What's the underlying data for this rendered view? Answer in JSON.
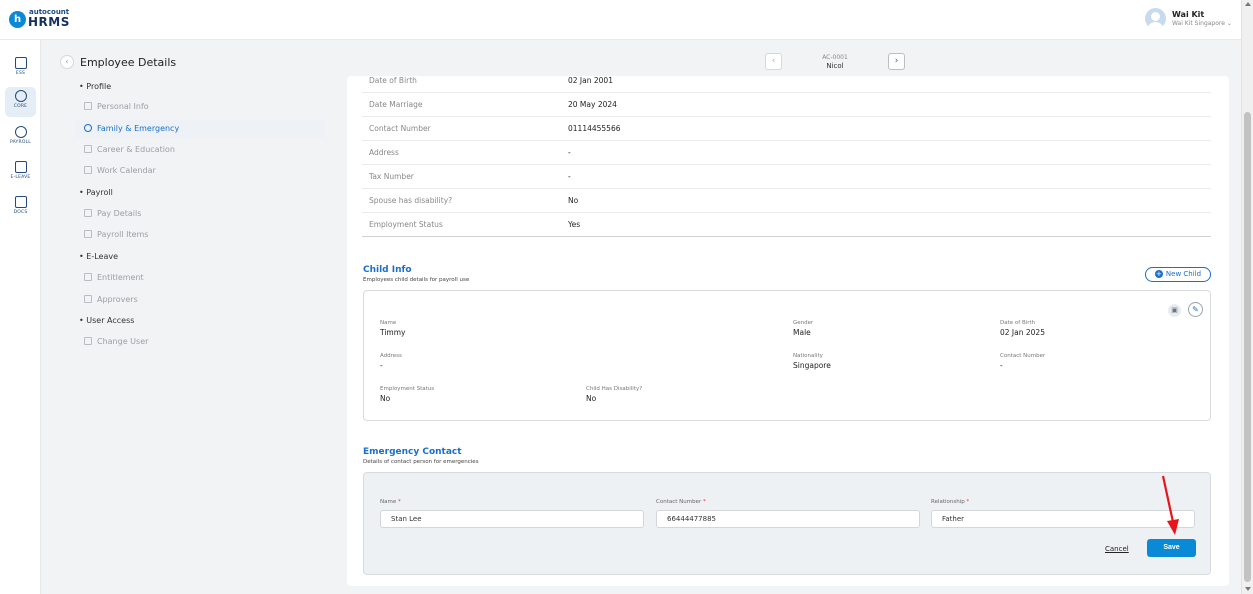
{
  "brand": {
    "logo_letter": "h",
    "small": "autocount",
    "big": "HRMS"
  },
  "user": {
    "name": "Wai Kit",
    "company": "Wai Kit Singapore ⌄"
  },
  "nav": [
    {
      "label": "ESS",
      "icon": "ess-icon"
    },
    {
      "label": "CORE",
      "icon": "core-icon",
      "active": true
    },
    {
      "label": "PAYROLL",
      "icon": "payroll-icon"
    },
    {
      "label": "E-LEAVE",
      "icon": "calendar-icon"
    },
    {
      "label": "DOCS",
      "icon": "docs-icon"
    }
  ],
  "header": {
    "title": "Employee Details",
    "emp_code": "AC-0001",
    "emp_name": "Nicol"
  },
  "menu": {
    "groups": [
      "Profile",
      "Payroll",
      "E-Leave",
      "User Access"
    ],
    "items": [
      "Personal Info",
      "Family & Emergency",
      "Career & Education",
      "Work Calendar",
      "Pay Details",
      "Payroll Items",
      "Entitlement",
      "Approvers",
      "Change User"
    ]
  },
  "spouse": [
    {
      "label": "Date of Birth",
      "value": "02 Jan 2001"
    },
    {
      "label": "Date Marriage",
      "value": "20 May 2024"
    },
    {
      "label": "Contact Number",
      "value": "01114455566"
    },
    {
      "label": "Address",
      "value": "-"
    },
    {
      "label": "Tax Number",
      "value": "-"
    },
    {
      "label": "Spouse has disability?",
      "value": "No"
    },
    {
      "label": "Employment Status",
      "value": "Yes"
    }
  ],
  "child_info": {
    "title": "Child Info",
    "subtitle": "Employees child details for payroll use",
    "new_button": "New Child",
    "fields": {
      "name_label": "Name",
      "name": "Timmy",
      "gender_label": "Gender",
      "gender": "Male",
      "dob_label": "Date of Birth",
      "dob": "02 Jan 2025",
      "address_label": "Address",
      "address": "-",
      "nationality_label": "Nationality",
      "nationality": "Singapore",
      "contact_label": "Contact Number",
      "contact": "-",
      "employment_label": "Employment Status",
      "employment": "No",
      "disability_label": "Child Has Disability?",
      "disability": "No"
    }
  },
  "emergency": {
    "title": "Emergency Contact",
    "subtitle": "Details of contact person for emergencies",
    "name_label": "Name",
    "name_value": "Stan Lee",
    "contact_label": "Contact Number",
    "contact_value": "66444477885",
    "relationship_label": "Relationship",
    "relationship_value": "Father",
    "required_mark": "*",
    "cancel": "Cancel",
    "save": "Save"
  },
  "colors": {
    "accent": "#0a8ad6",
    "link": "#1a6fc9",
    "annotation_arrow": "#e8141b"
  }
}
